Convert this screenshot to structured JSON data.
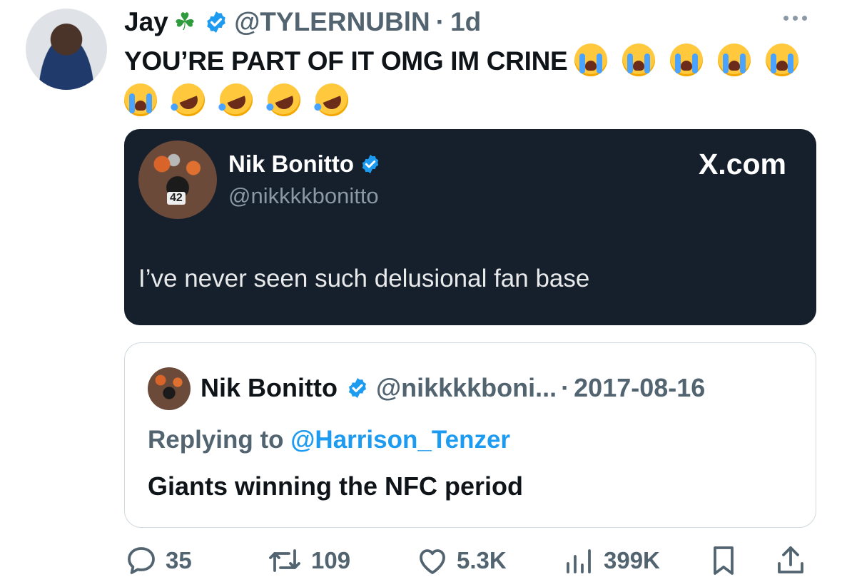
{
  "tweet": {
    "author_name": "Jay",
    "author_emoji": "☘",
    "handle": "@TYLERNUBlN",
    "dot": "·",
    "time": "1d",
    "text": "YOU’RE PART OF IT OMG IM CRINE",
    "emojis": [
      "loudly-crying-face",
      "loudly-crying-face",
      "loudly-crying-face",
      "loudly-crying-face",
      "loudly-crying-face",
      "loudly-crying-face",
      "rolling-on-floor-laughing",
      "rolling-on-floor-laughing",
      "rolling-on-floor-laughing",
      "rolling-on-floor-laughing"
    ]
  },
  "embedded_card": {
    "name": "Nik Bonitto",
    "handle": "@nikkkkbonitto",
    "site": "X.com",
    "text": "I’ve never seen such delusional fan base",
    "avatar_number": "42"
  },
  "quoted": {
    "name": "Nik Bonitto",
    "handle": "@nikkkkboni...",
    "dot": "·",
    "date": "2017-08-16",
    "replying_prefix": "Replying to",
    "replying_to": "@Harrison_Tenzer",
    "text": "Giants winning the NFC period"
  },
  "actions": {
    "replies": "35",
    "reposts": "109",
    "likes": "5.3K",
    "views": "399K"
  },
  "colors": {
    "verified": "#1d9bf0",
    "muted": "#536471",
    "card_dark": "#16202c",
    "link": "#1d9bf0"
  }
}
